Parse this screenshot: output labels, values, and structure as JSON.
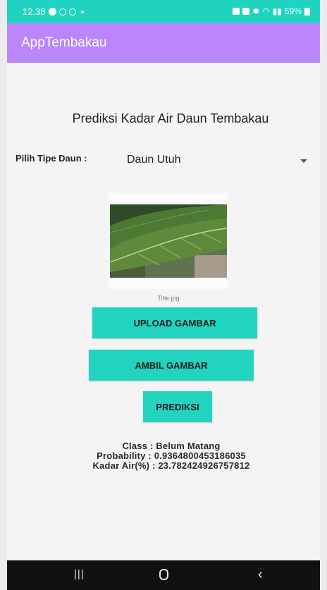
{
  "status_bar": {
    "time": "12.38",
    "battery": "59%"
  },
  "app_bar": {
    "title": "AppTembakau"
  },
  "main": {
    "heading": "Prediksi Kadar Air Daun Tembakau",
    "picker_label": "Pilih Tipe Daun :",
    "picker_value": "Daun Utuh",
    "image_caption": "Title.jpg",
    "buttons": {
      "upload": "UPLOAD GAMBAR",
      "ambil": "AMBIL GAMBAR",
      "prediksi": "PREDIKSI"
    },
    "results": {
      "class_line": "Class : Belum Matang",
      "probability_line": "Probability : 0.9364800453186035",
      "kadar_line": "Kadar Air(%) : 23.782424926757812"
    }
  },
  "nav": {
    "recent_icon": "recent-apps-icon",
    "home_icon": "home-icon",
    "back_icon": "back-icon"
  },
  "colors": {
    "status_bar": "#20d3c0",
    "app_bar": "#bb86fc",
    "button": "#22d3c0",
    "nav_bar": "#111111"
  }
}
